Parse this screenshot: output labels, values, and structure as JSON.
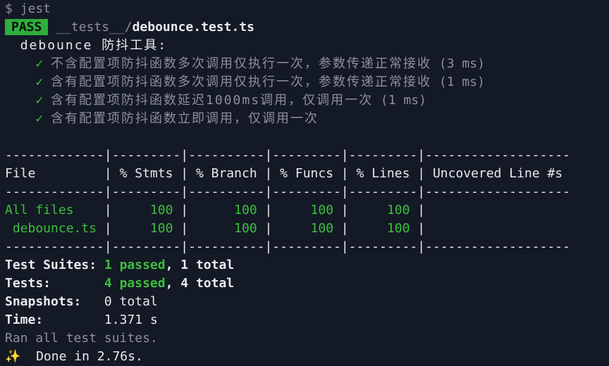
{
  "prompt": "$ jest",
  "result": {
    "badge": "PASS",
    "path_dir": "__tests__/",
    "path_file": "debounce.test.ts"
  },
  "suite_name": "debounce 防抖工具:",
  "check_icon": "✓",
  "tests": [
    {
      "name": "不含配置项防抖函数多次调用仅执行一次，参数传递正常接收",
      "time": " (3 ms)"
    },
    {
      "name": "含有配置项防抖函数多次调用仅执行一次，参数传递正常接收",
      "time": " (1 ms)"
    },
    {
      "name": "含有配置项防抖函数延迟1000ms调用，仅调用一次",
      "time": " (1 ms)"
    },
    {
      "name": "含有配置项防抖函数立即调用，仅调用一次",
      "time": ""
    }
  ],
  "coverage": {
    "separator": "-------------|---------|----------|---------|---------|-------------------",
    "headers": [
      "File",
      "% Stmts",
      "% Branch",
      "% Funcs",
      "% Lines",
      "Uncovered Line #s"
    ],
    "rows": [
      {
        "file": "All files",
        "stmts": "100",
        "branch": "100",
        "funcs": "100",
        "lines": "100",
        "uncovered": ""
      },
      {
        "file": " debounce.ts",
        "stmts": "100",
        "branch": "100",
        "funcs": "100",
        "lines": "100",
        "uncovered": ""
      }
    ]
  },
  "summary": {
    "suites_label": "Test Suites: ",
    "suites_passed": "1 passed",
    "suites_total": ", 1 total",
    "tests_label": "Tests:       ",
    "tests_passed": "4 passed",
    "tests_total": ", 4 total",
    "snapshots_label": "Snapshots:   ",
    "snapshots_value": "0 total",
    "time_label": "Time:        ",
    "time_value": "1.371 s",
    "ran_all": "Ran all test suites.",
    "done_icon": "✨",
    "done": "  Done in 2.76s."
  }
}
